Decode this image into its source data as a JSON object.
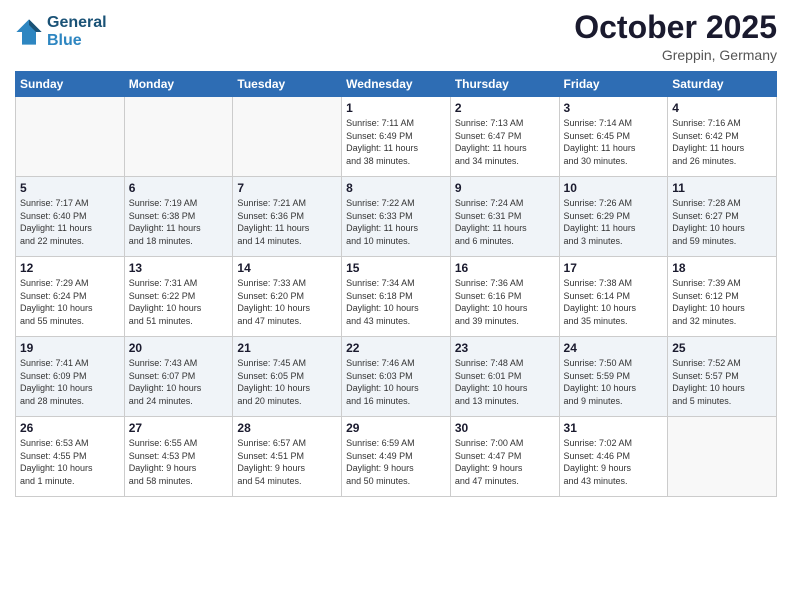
{
  "logo": {
    "line1": "General",
    "line2": "Blue"
  },
  "header": {
    "month": "October 2025",
    "location": "Greppin, Germany"
  },
  "days_of_week": [
    "Sunday",
    "Monday",
    "Tuesday",
    "Wednesday",
    "Thursday",
    "Friday",
    "Saturday"
  ],
  "weeks": [
    [
      {
        "day": "",
        "info": ""
      },
      {
        "day": "",
        "info": ""
      },
      {
        "day": "",
        "info": ""
      },
      {
        "day": "1",
        "info": "Sunrise: 7:11 AM\nSunset: 6:49 PM\nDaylight: 11 hours\nand 38 minutes."
      },
      {
        "day": "2",
        "info": "Sunrise: 7:13 AM\nSunset: 6:47 PM\nDaylight: 11 hours\nand 34 minutes."
      },
      {
        "day": "3",
        "info": "Sunrise: 7:14 AM\nSunset: 6:45 PM\nDaylight: 11 hours\nand 30 minutes."
      },
      {
        "day": "4",
        "info": "Sunrise: 7:16 AM\nSunset: 6:42 PM\nDaylight: 11 hours\nand 26 minutes."
      }
    ],
    [
      {
        "day": "5",
        "info": "Sunrise: 7:17 AM\nSunset: 6:40 PM\nDaylight: 11 hours\nand 22 minutes."
      },
      {
        "day": "6",
        "info": "Sunrise: 7:19 AM\nSunset: 6:38 PM\nDaylight: 11 hours\nand 18 minutes."
      },
      {
        "day": "7",
        "info": "Sunrise: 7:21 AM\nSunset: 6:36 PM\nDaylight: 11 hours\nand 14 minutes."
      },
      {
        "day": "8",
        "info": "Sunrise: 7:22 AM\nSunset: 6:33 PM\nDaylight: 11 hours\nand 10 minutes."
      },
      {
        "day": "9",
        "info": "Sunrise: 7:24 AM\nSunset: 6:31 PM\nDaylight: 11 hours\nand 6 minutes."
      },
      {
        "day": "10",
        "info": "Sunrise: 7:26 AM\nSunset: 6:29 PM\nDaylight: 11 hours\nand 3 minutes."
      },
      {
        "day": "11",
        "info": "Sunrise: 7:28 AM\nSunset: 6:27 PM\nDaylight: 10 hours\nand 59 minutes."
      }
    ],
    [
      {
        "day": "12",
        "info": "Sunrise: 7:29 AM\nSunset: 6:24 PM\nDaylight: 10 hours\nand 55 minutes."
      },
      {
        "day": "13",
        "info": "Sunrise: 7:31 AM\nSunset: 6:22 PM\nDaylight: 10 hours\nand 51 minutes."
      },
      {
        "day": "14",
        "info": "Sunrise: 7:33 AM\nSunset: 6:20 PM\nDaylight: 10 hours\nand 47 minutes."
      },
      {
        "day": "15",
        "info": "Sunrise: 7:34 AM\nSunset: 6:18 PM\nDaylight: 10 hours\nand 43 minutes."
      },
      {
        "day": "16",
        "info": "Sunrise: 7:36 AM\nSunset: 6:16 PM\nDaylight: 10 hours\nand 39 minutes."
      },
      {
        "day": "17",
        "info": "Sunrise: 7:38 AM\nSunset: 6:14 PM\nDaylight: 10 hours\nand 35 minutes."
      },
      {
        "day": "18",
        "info": "Sunrise: 7:39 AM\nSunset: 6:12 PM\nDaylight: 10 hours\nand 32 minutes."
      }
    ],
    [
      {
        "day": "19",
        "info": "Sunrise: 7:41 AM\nSunset: 6:09 PM\nDaylight: 10 hours\nand 28 minutes."
      },
      {
        "day": "20",
        "info": "Sunrise: 7:43 AM\nSunset: 6:07 PM\nDaylight: 10 hours\nand 24 minutes."
      },
      {
        "day": "21",
        "info": "Sunrise: 7:45 AM\nSunset: 6:05 PM\nDaylight: 10 hours\nand 20 minutes."
      },
      {
        "day": "22",
        "info": "Sunrise: 7:46 AM\nSunset: 6:03 PM\nDaylight: 10 hours\nand 16 minutes."
      },
      {
        "day": "23",
        "info": "Sunrise: 7:48 AM\nSunset: 6:01 PM\nDaylight: 10 hours\nand 13 minutes."
      },
      {
        "day": "24",
        "info": "Sunrise: 7:50 AM\nSunset: 5:59 PM\nDaylight: 10 hours\nand 9 minutes."
      },
      {
        "day": "25",
        "info": "Sunrise: 7:52 AM\nSunset: 5:57 PM\nDaylight: 10 hours\nand 5 minutes."
      }
    ],
    [
      {
        "day": "26",
        "info": "Sunrise: 6:53 AM\nSunset: 4:55 PM\nDaylight: 10 hours\nand 1 minute."
      },
      {
        "day": "27",
        "info": "Sunrise: 6:55 AM\nSunset: 4:53 PM\nDaylight: 9 hours\nand 58 minutes."
      },
      {
        "day": "28",
        "info": "Sunrise: 6:57 AM\nSunset: 4:51 PM\nDaylight: 9 hours\nand 54 minutes."
      },
      {
        "day": "29",
        "info": "Sunrise: 6:59 AM\nSunset: 4:49 PM\nDaylight: 9 hours\nand 50 minutes."
      },
      {
        "day": "30",
        "info": "Sunrise: 7:00 AM\nSunset: 4:47 PM\nDaylight: 9 hours\nand 47 minutes."
      },
      {
        "day": "31",
        "info": "Sunrise: 7:02 AM\nSunset: 4:46 PM\nDaylight: 9 hours\nand 43 minutes."
      },
      {
        "day": "",
        "info": ""
      }
    ]
  ]
}
